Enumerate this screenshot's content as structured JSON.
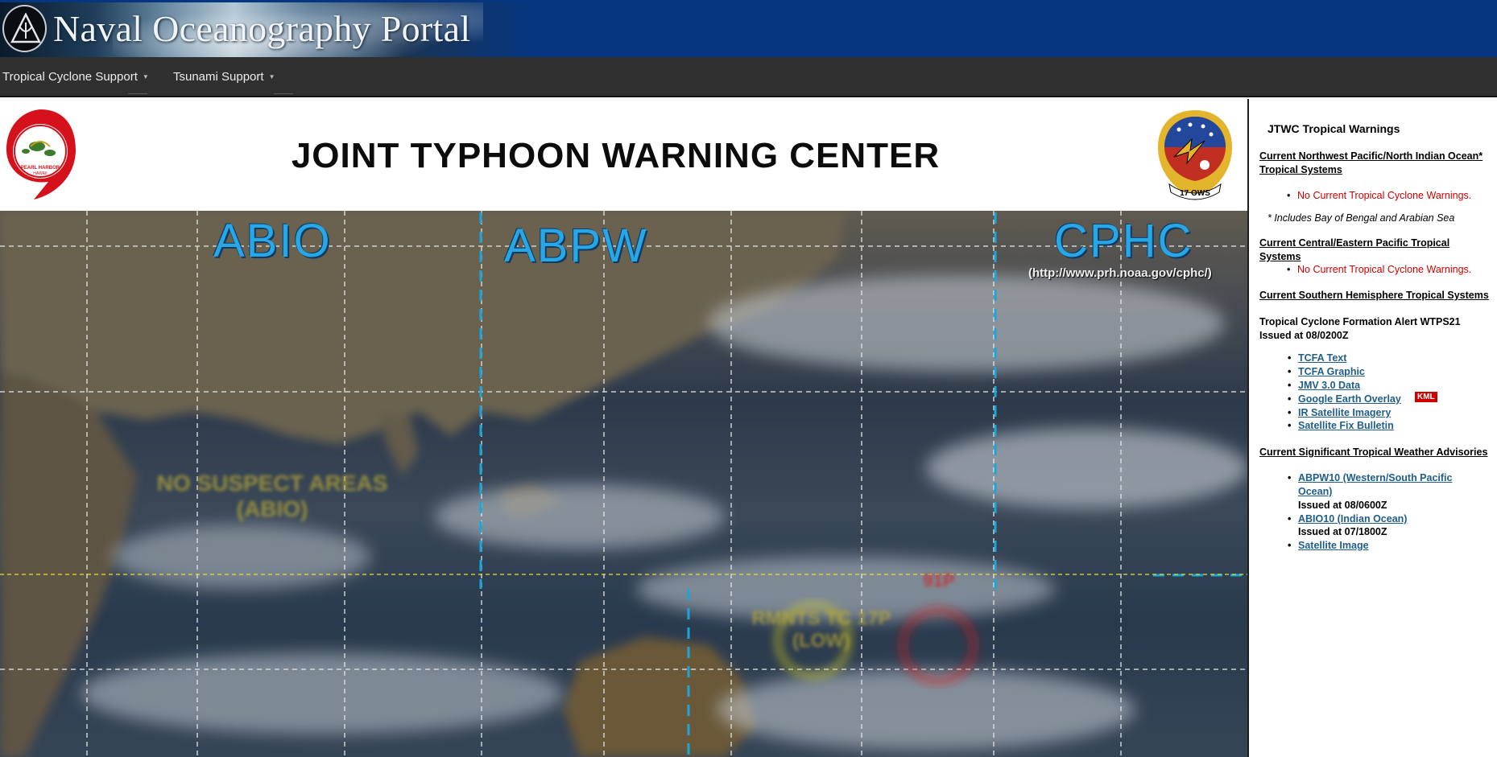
{
  "banner": {
    "title": "Naval Oceanography Portal"
  },
  "nav": {
    "items": [
      {
        "label": "Tropical Cyclone Support"
      },
      {
        "label": "Tsunami Support"
      }
    ]
  },
  "header": {
    "title": "JOINT TYPHOON WARNING CENTER",
    "left_seal_text": "JOINT TYPHOON WARNING CENTER · PEARL HARBOR HAWAII",
    "right_seal_text": "17 OWS"
  },
  "map": {
    "regions": [
      {
        "label": "ABIO"
      },
      {
        "label": "ABPW"
      },
      {
        "label": "CPHC"
      }
    ],
    "cphc_url": "(http://www.prh.noaa.gov/cphc/)",
    "notes": {
      "abio_status": "NO SUSPECT AREAS",
      "abio_tag": "(ABIO)",
      "remnants": "RMNTS TC 17P",
      "remnants_tag": "(LOW)",
      "invest": "91P"
    }
  },
  "sidebar": {
    "title": "JTWC Tropical Warnings",
    "nw_pacific_heading": "Current Northwest Pacific/North Indian Ocean* Tropical Systems",
    "nw_pacific_status": "No Current Tropical Cyclone Warnings.",
    "footnote": "* Includes Bay of Bengal and Arabian Sea",
    "central_heading": "Current Central/Eastern Pacific Tropical Systems",
    "central_status": "No Current Tropical Cyclone Warnings.",
    "southern_heading": "Current Southern Hemisphere Tropical Systems",
    "alert_title": "Tropical Cyclone Formation Alert WTPS21",
    "alert_issued": "Issued at 08/0200Z",
    "alert_links": [
      {
        "label": "TCFA Text"
      },
      {
        "label": "TCFA Graphic"
      },
      {
        "label": "JMV 3.0 Data"
      },
      {
        "label": "Google Earth Overlay"
      },
      {
        "label": "IR Satellite Imagery"
      },
      {
        "label": "Satellite Fix Bulletin"
      }
    ],
    "kml_badge": "KML",
    "advisories_heading": "Current Significant Tropical Weather Advisories",
    "advisories": [
      {
        "label": "ABPW10 (Western/South Pacific Ocean)",
        "issued": "Issued at 08/0600Z"
      },
      {
        "label": "ABIO10 (Indian Ocean)",
        "issued": "Issued at 07/1800Z"
      },
      {
        "label": "Satellite Image"
      }
    ]
  }
}
